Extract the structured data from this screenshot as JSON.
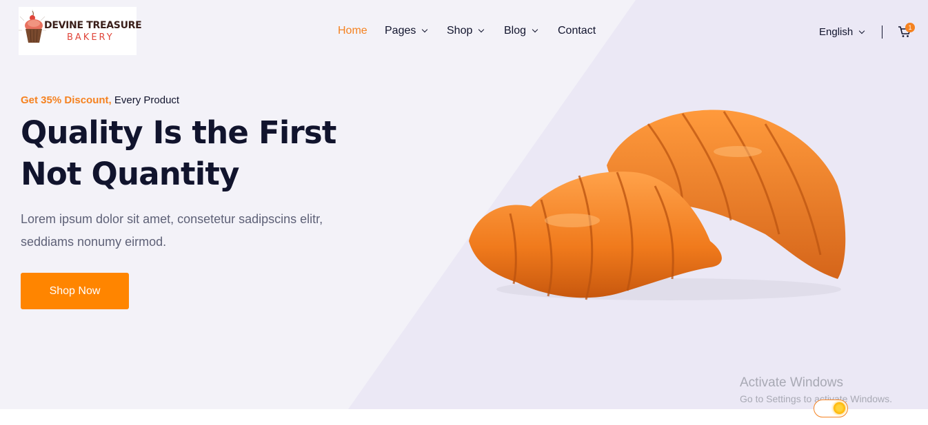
{
  "logo": {
    "line1": "DEVINE TREASURE",
    "line2": "BAKERY"
  },
  "nav": {
    "items": [
      {
        "label": "Home",
        "active": true,
        "has_dropdown": false
      },
      {
        "label": "Pages",
        "active": false,
        "has_dropdown": true
      },
      {
        "label": "Shop",
        "active": false,
        "has_dropdown": true
      },
      {
        "label": "Blog",
        "active": false,
        "has_dropdown": true
      },
      {
        "label": "Contact",
        "active": false,
        "has_dropdown": false
      }
    ]
  },
  "language": {
    "selected": "English"
  },
  "cart": {
    "count": "1"
  },
  "hero": {
    "discount_highlight": "Get 35% Discount,",
    "discount_rest": "Every Product",
    "headline_line1": "Quality Is the First",
    "headline_line2": "Not Quantity",
    "description_line1": "Lorem ipsum dolor sit amet, consetetur sadipscins elitr,",
    "description_line2": "seddiams nonumy eirmod.",
    "cta_label": "Shop Now"
  },
  "watermark": {
    "title": "Activate Windows",
    "subtitle": "Go to Settings to activate Windows."
  },
  "colors": {
    "accent": "#f58220",
    "button": "#ff8500",
    "text_dark": "#11142d",
    "hero_bg": "#f3f2f8",
    "hero_diag": "#ebe8f5"
  },
  "icons": [
    "cupcake-logo-icon",
    "chevron-down-icon",
    "cart-icon",
    "sun-icon"
  ]
}
